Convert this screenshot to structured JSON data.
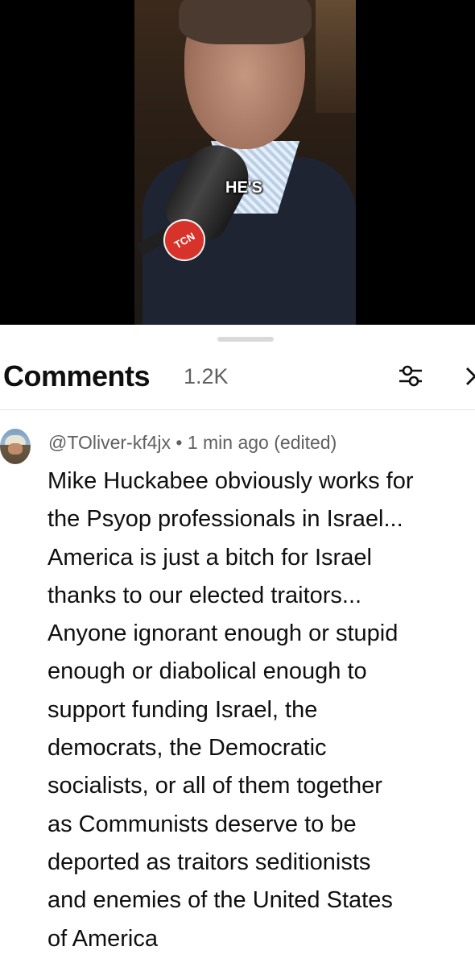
{
  "video": {
    "caption": "HE'S",
    "logo_text": "TCN"
  },
  "comments_panel": {
    "title": "Comments",
    "count": "1.2K",
    "filter_icon": "filter-sliders-icon",
    "close_icon": "close-chevron-icon"
  },
  "comment": {
    "author": "@TOliver-kf4jx",
    "separator": "•",
    "time": "1 min ago (edited)",
    "lines": [
      "Mike Huckabee obviously works for",
      "the Psyop professionals in Israel...",
      "America is just a bitch for Israel",
      "thanks to our elected traitors...",
      "Anyone ignorant enough or stupid",
      "enough or diabolical enough to",
      "support funding Israel, the",
      "democrats, the Democratic",
      "socialists, or all of them together",
      "as Communists deserve to be",
      "deported as traitors seditionists",
      "and enemies of the United States",
      "of America"
    ]
  },
  "colors": {
    "text_primary": "#0f0f0f",
    "text_secondary": "#606060",
    "divider": "#e5e5e5",
    "logo_red": "#d8332a"
  }
}
